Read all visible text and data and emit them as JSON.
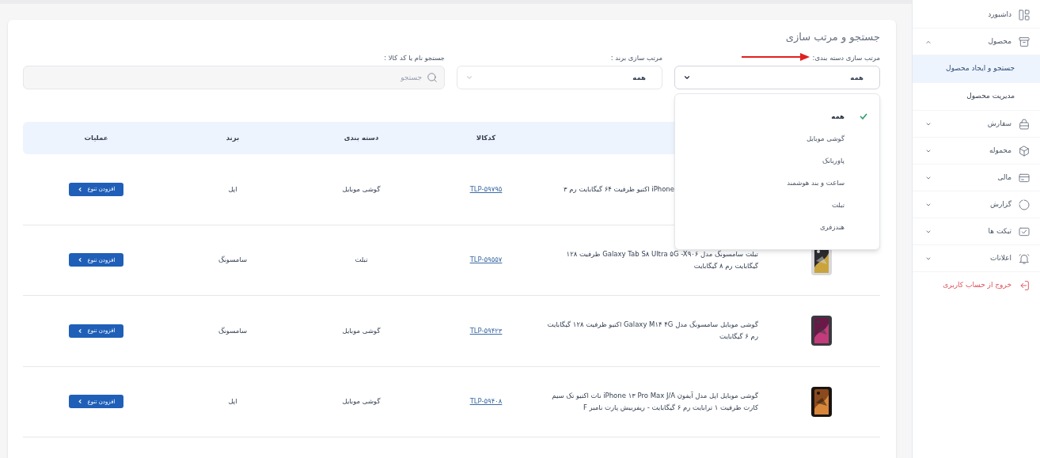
{
  "sidebar": {
    "items": [
      {
        "kind": "link",
        "label": "داشبورد"
      },
      {
        "kind": "group",
        "label": "محصول",
        "expanded": true,
        "children": [
          {
            "label": "جستجو و ایجاد محصول",
            "selected": true
          },
          {
            "label": "مدیریت محصول",
            "selected": false
          }
        ]
      },
      {
        "kind": "group",
        "label": "سفارش",
        "expanded": false
      },
      {
        "kind": "group",
        "label": "محموله",
        "expanded": false
      },
      {
        "kind": "group",
        "label": "مالی",
        "expanded": false
      },
      {
        "kind": "group",
        "label": "گزارش",
        "expanded": false
      },
      {
        "kind": "group",
        "label": "تیکت ها",
        "expanded": false
      },
      {
        "kind": "group",
        "label": "اعلانات",
        "expanded": false
      },
      {
        "kind": "logout",
        "label": "خروج از حساب کاربری"
      }
    ]
  },
  "panel": {
    "title": "جستجو و مرتب سازی",
    "filters": [
      {
        "kind": "select",
        "label": "مرتب سازی دسته بندی:",
        "value": "همه",
        "open": true,
        "options": [
          {
            "label": "همه",
            "selected": true
          },
          {
            "label": "گوشی موبایل",
            "selected": false
          },
          {
            "label": "پاوربانک",
            "selected": false
          },
          {
            "label": "ساعت و بند هوشمند",
            "selected": false
          },
          {
            "label": "تبلت",
            "selected": false
          },
          {
            "label": "هندزفری",
            "selected": false
          }
        ]
      },
      {
        "kind": "select",
        "label": "مرتب سازی برند :",
        "value": "همه",
        "open": false
      },
      {
        "kind": "search",
        "label": "جستجو نام یا کد کالا :",
        "placeholder": "جستجو"
      }
    ]
  },
  "table": {
    "columns": [
      {
        "label": "کدکالا"
      },
      {
        "label": "دسته بندی"
      },
      {
        "label": "برند"
      },
      {
        "label": "عملیات"
      }
    ],
    "rows": [
      {
        "name": "iPhone اکتیو ظرفیت ۶۴ گیگابایت رم ۳",
        "covered": true,
        "code": "TLP-۵۹۷۹۵",
        "category": "گوشی موبایل",
        "brand": "اپل",
        "action": "افزودن تنوع"
      },
      {
        "name": "تبلت سامسونگ مدل Galaxy Tab S۸ Ultra ۵G -X۹۰۶ ظرفیت ۱۲۸ گیگابایت رم ۸ گیگابایت",
        "covered": false,
        "code": "TLP-۵۹۵۵۷",
        "category": "تبلت",
        "brand": "سامسونگ",
        "action": "افزودن تنوع"
      },
      {
        "name": "گوشی موبایل سامسونگ مدل Galaxy M۱۴ ۴G اکتیو ظرفیت ۱۲۸ گیگابایت رم ۶ گیگابایت",
        "covered": false,
        "code": "TLP-۵۹۴۲۳",
        "category": "گوشی موبایل",
        "brand": "سامسونگ",
        "action": "افزودن تنوع"
      },
      {
        "name": "گوشی موبایل اپل مدل آیفون iPhone ۱۳ Pro Max J/A نات اکتیو تک سیم کارت ظرفیت ۱ ترابایت رم ۶ گیگابایت - ریفربیش پارت نامبر F",
        "covered": false,
        "code": "TLP-۵۹۴۰۸",
        "category": "گوشی موبایل",
        "brand": "اپل",
        "action": "افزودن تنوع"
      }
    ]
  }
}
